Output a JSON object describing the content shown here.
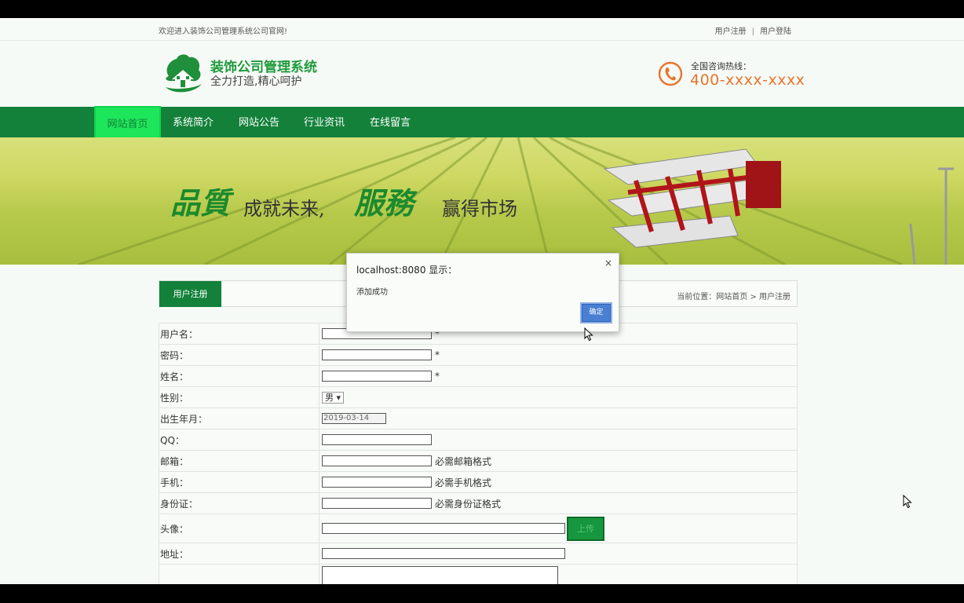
{
  "topbar": {
    "welcome": "欢迎进入装饰公司管理系统公司官网!",
    "register_link": "用户注册",
    "separator": "|",
    "login_link": "用户登陆"
  },
  "header": {
    "title": "装饰公司管理系统",
    "slogan": "全力打造,精心呵护",
    "hotline_label": "全国咨询热线：",
    "hotline_number": "400-xxxx-xxxx",
    "logo_icon": "house-leaf-icon",
    "phone_icon": "phone-icon"
  },
  "nav": {
    "items": [
      {
        "label": "网站首页",
        "active": true
      },
      {
        "label": "系统简介",
        "active": false
      },
      {
        "label": "网站公告",
        "active": false
      },
      {
        "label": "行业资讯",
        "active": false
      },
      {
        "label": "在线留言",
        "active": false
      }
    ]
  },
  "banner": {
    "part1": "品質",
    "part2": "成就未来,",
    "part3": "服務",
    "part4": "赢得市场"
  },
  "panel": {
    "tab": "用户注册",
    "breadcrumb": "当前位置：网站首页 > 用户注册"
  },
  "form": {
    "username_label": "用户名：",
    "password_label": "密码：",
    "name_label": "姓名：",
    "gender_label": "性别：",
    "gender_value": "男",
    "birth_label": "出生年月：",
    "birth_value": "2019-03-14",
    "qq_label": "QQ：",
    "email_label": "邮箱：",
    "email_hint": "必需邮箱格式",
    "mobile_label": "手机：",
    "mobile_hint": "必需手机格式",
    "idcard_label": "身份证：",
    "idcard_hint": "必需身份证格式",
    "avatar_label": "头像：",
    "upload_label": "上传",
    "address_label": "地址：",
    "required_mark": "*"
  },
  "dialog": {
    "title": "localhost:8080 显示：",
    "message": "添加成功",
    "ok": "确定",
    "close": "×"
  },
  "colors": {
    "brand_green": "#13813a",
    "active_nav": "#1ee65a",
    "hotline": "#e8742c",
    "ok_button": "#4a7fd2"
  }
}
